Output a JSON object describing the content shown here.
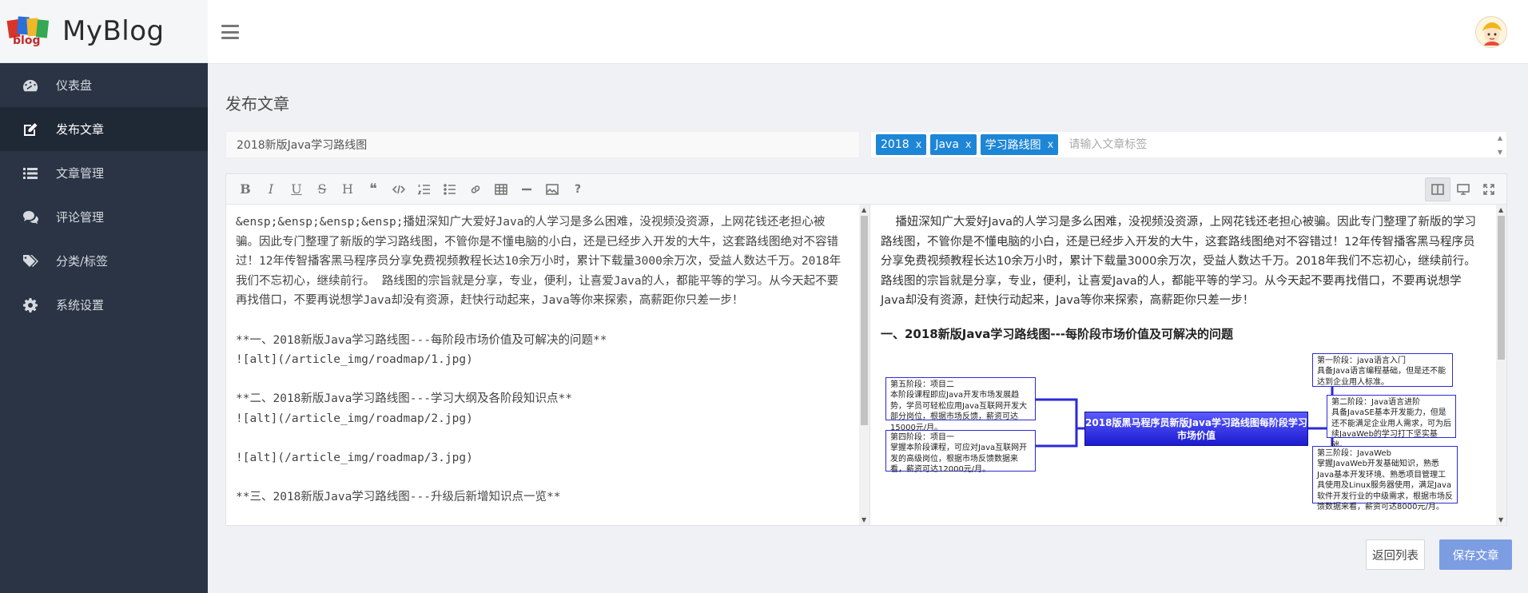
{
  "brand": {
    "logo_text": "blog",
    "name": "MyBlog"
  },
  "sidebar": {
    "items": [
      {
        "label": "仪表盘",
        "icon": "dashboard-icon",
        "active": false
      },
      {
        "label": "发布文章",
        "icon": "edit-icon",
        "active": true
      },
      {
        "label": "文章管理",
        "icon": "list-icon",
        "active": false
      },
      {
        "label": "评论管理",
        "icon": "comments-icon",
        "active": false
      },
      {
        "label": "分类/标签",
        "icon": "tags-icon",
        "active": false
      },
      {
        "label": "系统设置",
        "icon": "gear-icon",
        "active": false
      }
    ]
  },
  "header": {
    "menu_icon": "hamburger-icon",
    "avatar_icon": "user-avatar-icon"
  },
  "page": {
    "title": "发布文章"
  },
  "form": {
    "title_value": "2018新版Java学习路线图",
    "tags": [
      "2018",
      "Java",
      "学习路线图"
    ],
    "tag_remove": "x",
    "tag_placeholder": "请输入文章标签"
  },
  "toolbar": {
    "left": [
      "bold-icon",
      "italic-icon",
      "underline-icon",
      "strikethrough-icon",
      "heading-icon",
      "quote-icon",
      "code-icon",
      "ordered-list-icon",
      "unordered-list-icon",
      "link-icon",
      "table-icon",
      "horizontal-rule-icon",
      "image-icon",
      "help-icon"
    ],
    "right": [
      "split-view-icon",
      "preview-icon",
      "fullscreen-icon"
    ]
  },
  "editor": {
    "markdown": "&ensp;&ensp;&ensp;&ensp;播妞深知广大爱好Java的人学习是多么困难，没视频没资源，上网花钱还老担心被骗。因此专门整理了新版的学习路线图，不管你是不懂电脑的小白，还是已经步入开发的大牛，这套路线图绝对不容错过！12年传智播客黑马程序员分享免费视频教程长达10余万小时，累计下载量3000余万次，受益人数达千万。2018年我们不忘初心，继续前行。 路线图的宗旨就是分享，专业，便利，让喜爱Java的人，都能平等的学习。从今天起不要再找借口，不要再说想学Java却没有资源，赶快行动起来，Java等你来探索，高薪距你只差一步！\n\n**一、2018新版Java学习路线图---每阶段市场价值及可解决的问题**\n![alt](/article_img/roadmap/1.jpg)\n\n**二、2018新版Java学习路线图---学习大纲及各阶段知识点**\n![alt](/article_img/roadmap/2.jpg)\n\n![alt](/article_img/roadmap/3.jpg)\n\n**三、2018新版Java学习路线图---升级后新增知识点一览**"
  },
  "preview": {
    "paragraph": "    播妞深知广大爱好Java的人学习是多么困难，没视频没资源，上网花钱还老担心被骗。因此专门整理了新版的学习路线图，不管你是不懂电脑的小白，还是已经步入开发的大牛，这套路线图绝对不容错过！12年传智播客黑马程序员分享免费视频教程长达10余万小时，累计下载量3000余万次，受益人数达千万。2018年我们不忘初心，继续前行。 路线图的宗旨就是分享，专业，便利，让喜爱Java的人，都能平等的学习。从今天起不要再找借口，不要再说想学Java却没有资源，赶快行动起来，Java等你来探索，高薪距你只差一步！",
    "heading": "一、2018新版Java学习路线图---每阶段市场价值及可解决的问题",
    "roadmap": {
      "center": "2018版黑马程序员新版Java学习路线图每阶段学习市场价值",
      "stage5": "第五阶段：项目二\n本阶段课程即应Java开发市场发展趋势，学员可轻松应用Java互联网开发大部分岗位，根据市场反馈，薪资可达15000元/月。",
      "stage4": "第四阶段：项目一\n掌握本阶段课程，可应对Java互联网开发的高级岗位，根据市场反馈数据来看，薪资可达12000元/月。",
      "stage1": "第一阶段：java语言入门\n具备Java语言编程基础，但是还不能达到企业用人标准。",
      "stage2": "第二阶段：Java语言进阶\n具备JavaSE基本开发能力，但是还不能满足企业用人需求，可为后续JavaWeb的学习打下坚实基础。",
      "stage3": "第三阶段：JavaWeb\n掌握JavaWeb开发基础知识，熟悉Java基本开发环境、熟悉项目管理工具使用及Linux服务器使用，满足Java软件开发行业的中级需求，根据市场反馈数据来看，薪资可达8000元/月。"
    }
  },
  "actions": {
    "back_label": "返回列表",
    "save_label": "保存文章"
  }
}
